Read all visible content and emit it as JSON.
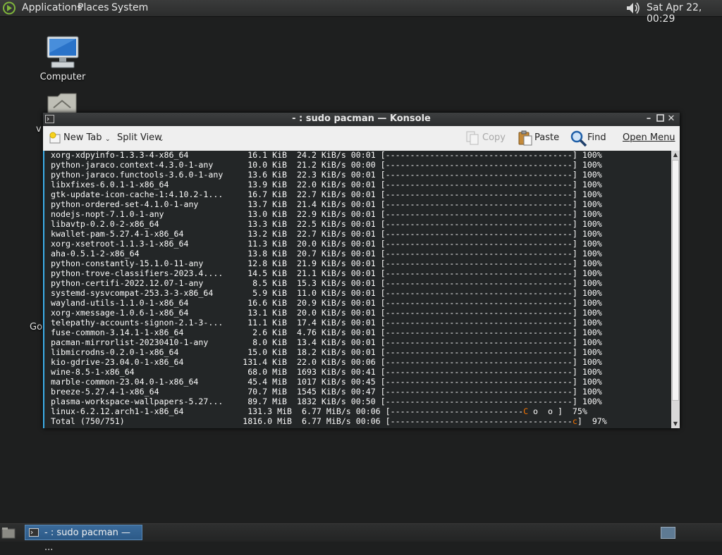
{
  "top_panel": {
    "menus": [
      "Applications",
      "Places",
      "System"
    ],
    "clock": "Sat Apr 22, 00:29"
  },
  "desktop": {
    "computer_label": "Computer",
    "partial_label_1": "v",
    "partial_label_2": "Go"
  },
  "window": {
    "title": "- : sudo pacman — Konsole"
  },
  "toolbar": {
    "new_tab": "New Tab",
    "split_view": "Split View",
    "copy": "Copy",
    "paste": "Paste",
    "find": "Find",
    "open_menu": "Open Menu"
  },
  "terminal": {
    "lines": [
      "xorg-xdpyinfo-1.3.3-4-x86_64            16.1 KiB  24.2 KiB/s 00:01 [--------------------------------------] 100%",
      "python-jaraco.context-4.3.0-1-any       10.0 KiB  21.2 KiB/s 00:00 [--------------------------------------] 100%",
      "python-jaraco.functools-3.6.0-1-any     13.6 KiB  22.3 KiB/s 00:01 [--------------------------------------] 100%",
      "libxfixes-6.0.1-1-x86_64                13.9 KiB  22.0 KiB/s 00:01 [--------------------------------------] 100%",
      "gtk-update-icon-cache-1:4.10.2-1...     16.7 KiB  22.7 KiB/s 00:01 [--------------------------------------] 100%",
      "python-ordered-set-4.1.0-1-any          13.7 KiB  21.4 KiB/s 00:01 [--------------------------------------] 100%",
      "nodejs-nopt-7.1.0-1-any                 13.0 KiB  22.9 KiB/s 00:01 [--------------------------------------] 100%",
      "libavtp-0.2.0-2-x86_64                  13.3 KiB  22.5 KiB/s 00:01 [--------------------------------------] 100%",
      "kwallet-pam-5.27.4-1-x86_64             13.2 KiB  22.7 KiB/s 00:01 [--------------------------------------] 100%",
      "xorg-xsetroot-1.1.3-1-x86_64            11.3 KiB  20.0 KiB/s 00:01 [--------------------------------------] 100%",
      "aha-0.5.1-2-x86_64                      13.8 KiB  20.7 KiB/s 00:01 [--------------------------------------] 100%",
      "python-constantly-15.1.0-11-any         12.8 KiB  21.9 KiB/s 00:01 [--------------------------------------] 100%",
      "python-trove-classifiers-2023.4....     14.5 KiB  21.1 KiB/s 00:01 [--------------------------------------] 100%",
      "python-certifi-2022.12.07-1-any          8.5 KiB  15.3 KiB/s 00:01 [--------------------------------------] 100%",
      "systemd-sysvcompat-253.3-3-x86_64        5.9 KiB  11.0 KiB/s 00:01 [--------------------------------------] 100%",
      "wayland-utils-1.1.0-1-x86_64            16.6 KiB  20.9 KiB/s 00:01 [--------------------------------------] 100%",
      "xorg-xmessage-1.0.6-1-x86_64            13.1 KiB  20.0 KiB/s 00:01 [--------------------------------------] 100%",
      "telepathy-accounts-signon-2.1-3-...     11.1 KiB  17.4 KiB/s 00:01 [--------------------------------------] 100%",
      "fuse-common-3.14.1-1-x86_64              2.6 KiB  4.76 KiB/s 00:01 [--------------------------------------] 100%",
      "pacman-mirrorlist-20230410-1-any         8.0 KiB  13.4 KiB/s 00:01 [--------------------------------------] 100%",
      "libmicrodns-0.2.0-1-x86_64              15.0 KiB  18.2 KiB/s 00:01 [--------------------------------------] 100%",
      "kio-gdrive-23.04.0-1-x86_64            131.4 KiB  22.0 KiB/s 00:06 [--------------------------------------] 100%",
      "wine-8.5-1-x86_64                       68.0 MiB  1693 KiB/s 00:41 [--------------------------------------] 100%",
      "marble-common-23.04.0-1-x86_64          45.4 MiB  1017 KiB/s 00:45 [--------------------------------------] 100%",
      "breeze-5.27.4-1-x86_64                  70.7 MiB  1545 KiB/s 00:47 [--------------------------------------] 100%",
      "plasma-workspace-wallpapers-5.27...     89.7 MiB  1832 KiB/s 00:50 [--------------------------------------] 100%"
    ],
    "line_linux_a": "linux-6.2.12.arch1-1-x86_64             131.3 MiB  6.77 MiB/s 00:06 [---------------------------",
    "line_linux_b": "C",
    "line_linux_c": " o  o ]  75%",
    "line_total_a": "Total (750/751)                        1816.0 MiB  6.77 MiB/s 00:06 [-------------------------------------",
    "line_total_b": "c",
    "line_total_c": "]  97%"
  },
  "taskbar": {
    "konsole_task": "- : sudo pacman — ..."
  },
  "colors": {
    "terminal_bg": "#232627",
    "pacman_orange": "#f67400",
    "accent": "#3daee9"
  }
}
